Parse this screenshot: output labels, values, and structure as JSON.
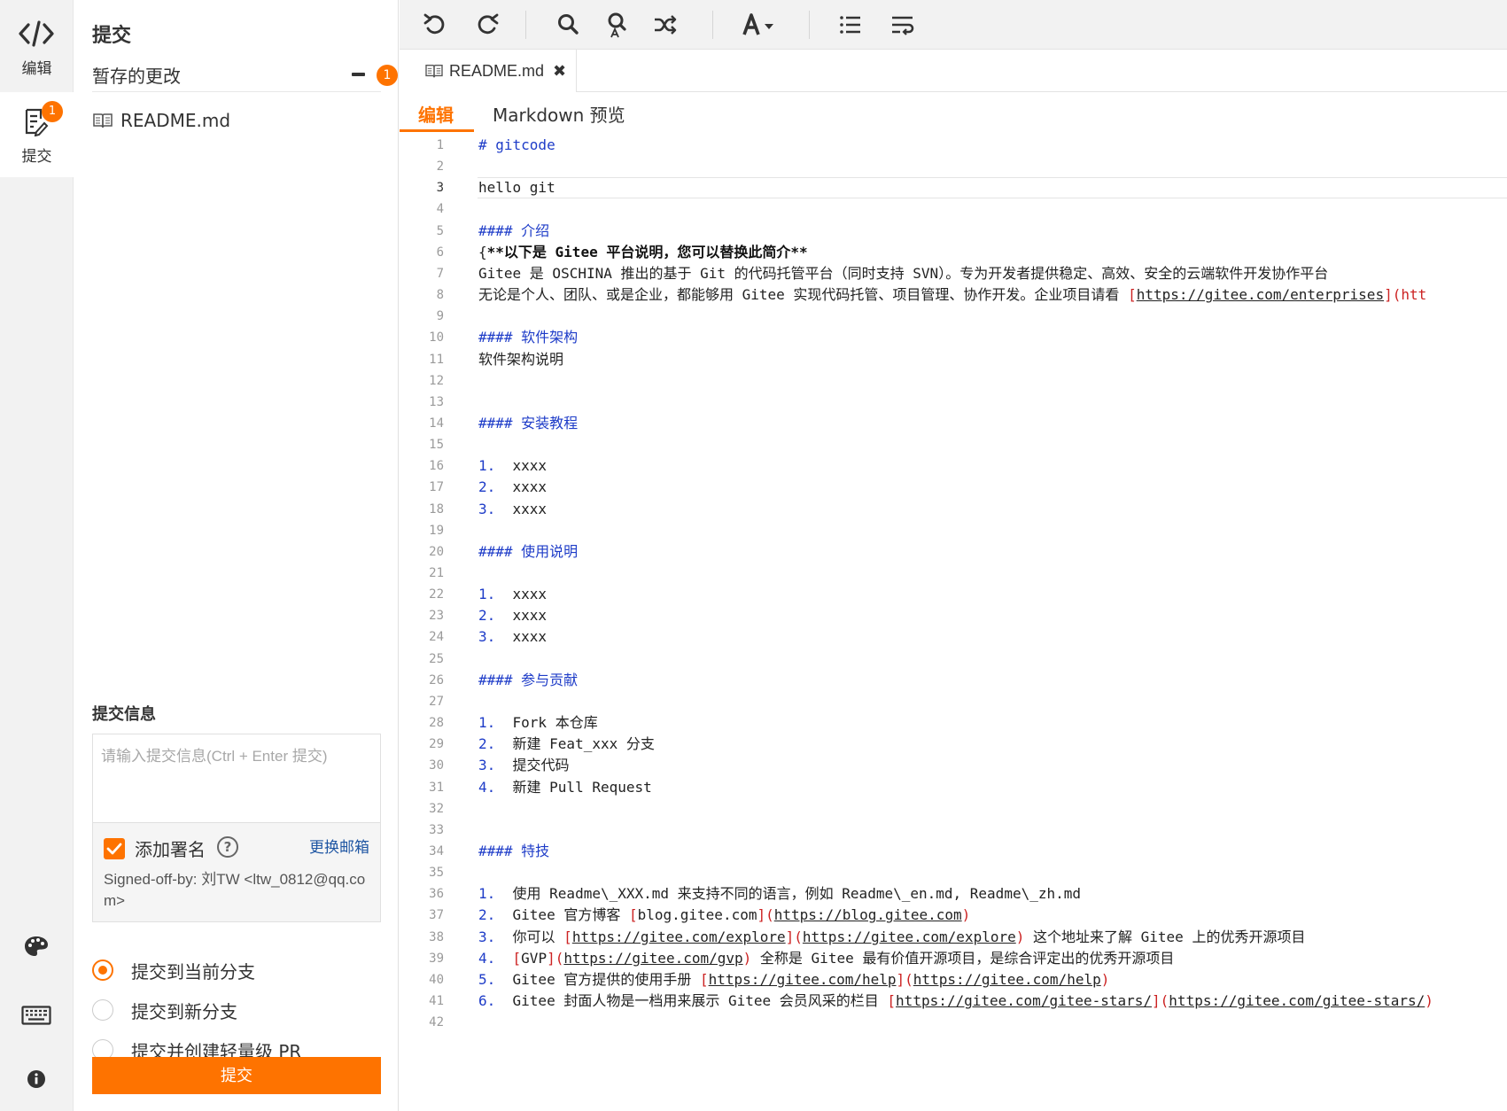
{
  "activity": {
    "edit_label": "编辑",
    "commit_label": "提交",
    "commit_badge": "1"
  },
  "panel": {
    "title": "提交",
    "staged_label": "暂存的更改",
    "staged_count": "1",
    "files": [
      "README.md"
    ],
    "message_title": "提交信息",
    "message_placeholder": "请输入提交信息(Ctrl + Enter 提交)",
    "add_signature_label": "添加署名",
    "change_email_label": "更换邮箱",
    "signed_off": "Signed-off-by: 刘TW <ltw_0812@qq.com>",
    "options": [
      "提交到当前分支",
      "提交到新分支",
      "提交并创建轻量级 PR"
    ],
    "selected_option": 0,
    "submit_label": "提交"
  },
  "editor": {
    "tab_name": "README.md",
    "tab_close": "✖",
    "mode_edit": "编辑",
    "mode_preview": "Markdown 预览",
    "current_line": 3,
    "line_count": 42,
    "lines": [
      [
        [
          "h",
          "# gitcode"
        ]
      ],
      [],
      [
        [
          "t",
          "hello git"
        ]
      ],
      [],
      [
        [
          "h",
          "#### 介绍"
        ]
      ],
      [
        [
          "t",
          "{"
        ],
        [
          "b",
          "**以下是 Gitee 平台说明，您可以替换此简介**"
        ]
      ],
      [
        [
          "t",
          "Gitee 是 OSCHINA 推出的基于 Git 的代码托管平台（同时支持 SVN）。专为开发者提供稳定、高效、安全的云端软件开发协作平台"
        ]
      ],
      [
        [
          "t",
          "无论是个人、团队、或是企业，都能够用 Gitee 实现代码托管、项目管理、协作开发。企业项目请看 "
        ],
        [
          "lk",
          "["
        ],
        [
          "u",
          "https://gitee.com/enterprises"
        ],
        [
          "lk",
          "](htt"
        ]
      ],
      [],
      [
        [
          "h",
          "#### 软件架构"
        ]
      ],
      [
        [
          "t",
          "软件架构说明"
        ]
      ],
      [],
      [],
      [
        [
          "h",
          "#### 安装教程"
        ]
      ],
      [],
      [
        [
          "n",
          "1.  "
        ],
        [
          "t",
          "xxxx"
        ]
      ],
      [
        [
          "n",
          "2.  "
        ],
        [
          "t",
          "xxxx"
        ]
      ],
      [
        [
          "n",
          "3.  "
        ],
        [
          "t",
          "xxxx"
        ]
      ],
      [],
      [
        [
          "h",
          "#### 使用说明"
        ]
      ],
      [],
      [
        [
          "n",
          "1.  "
        ],
        [
          "t",
          "xxxx"
        ]
      ],
      [
        [
          "n",
          "2.  "
        ],
        [
          "t",
          "xxxx"
        ]
      ],
      [
        [
          "n",
          "3.  "
        ],
        [
          "t",
          "xxxx"
        ]
      ],
      [],
      [
        [
          "h",
          "#### 参与贡献"
        ]
      ],
      [],
      [
        [
          "n",
          "1.  "
        ],
        [
          "t",
          "Fork 本仓库"
        ]
      ],
      [
        [
          "n",
          "2.  "
        ],
        [
          "t",
          "新建 Feat_xxx 分支"
        ]
      ],
      [
        [
          "n",
          "3.  "
        ],
        [
          "t",
          "提交代码"
        ]
      ],
      [
        [
          "n",
          "4.  "
        ],
        [
          "t",
          "新建 Pull Request"
        ]
      ],
      [],
      [],
      [
        [
          "h",
          "#### 特技"
        ]
      ],
      [],
      [
        [
          "n",
          "1.  "
        ],
        [
          "t",
          "使用 Readme\\_XXX.md 来支持不同的语言，例如 Readme\\_en.md, Readme\\_zh.md"
        ]
      ],
      [
        [
          "n",
          "2.  "
        ],
        [
          "t",
          "Gitee 官方博客 "
        ],
        [
          "lk",
          "["
        ],
        [
          "t",
          "blog.gitee.com"
        ],
        [
          "lk",
          "]("
        ],
        [
          "u",
          "https://blog.gitee.com"
        ],
        [
          "lk",
          ")"
        ]
      ],
      [
        [
          "n",
          "3.  "
        ],
        [
          "t",
          "你可以 "
        ],
        [
          "lk",
          "["
        ],
        [
          "u",
          "https://gitee.com/explore"
        ],
        [
          "lk",
          "]("
        ],
        [
          "u",
          "https://gitee.com/explore"
        ],
        [
          "lk",
          ")"
        ],
        [
          "t",
          " 这个地址来了解 Gitee 上的优秀开源项目"
        ]
      ],
      [
        [
          "n",
          "4.  "
        ],
        [
          "lk",
          "["
        ],
        [
          "t",
          "GVP"
        ],
        [
          "lk",
          "]("
        ],
        [
          "u",
          "https://gitee.com/gvp"
        ],
        [
          "lk",
          ")"
        ],
        [
          "t",
          " 全称是 Gitee 最有价值开源项目，是综合评定出的优秀开源项目"
        ]
      ],
      [
        [
          "n",
          "5.  "
        ],
        [
          "t",
          "Gitee 官方提供的使用手册 "
        ],
        [
          "lk",
          "["
        ],
        [
          "u",
          "https://gitee.com/help"
        ],
        [
          "lk",
          "]("
        ],
        [
          "u",
          "https://gitee.com/help"
        ],
        [
          "lk",
          ")"
        ]
      ],
      [
        [
          "n",
          "6.  "
        ],
        [
          "t",
          "Gitee 封面人物是一档用来展示 Gitee 会员风采的栏目 "
        ],
        [
          "lk",
          "["
        ],
        [
          "u",
          "https://gitee.com/gitee-stars/"
        ],
        [
          "lk",
          "]("
        ],
        [
          "u",
          "https://gitee.com/gitee-stars/"
        ],
        [
          "lk",
          ")"
        ]
      ],
      []
    ]
  },
  "icons": {
    "edit": "code-icon",
    "commit": "commit-list-icon",
    "theme": "palette-icon",
    "keyboard": "keyboard-icon",
    "info": "info-icon",
    "undo": "undo-icon",
    "redo": "redo-icon",
    "search": "search-icon",
    "replace": "find-replace-icon",
    "shuffle": "shuffle-icon",
    "font": "font-size-icon",
    "list": "list-icon",
    "wrap": "word-wrap-icon"
  },
  "colors": {
    "accent": "#fe7300",
    "link": "#1f56a3"
  }
}
